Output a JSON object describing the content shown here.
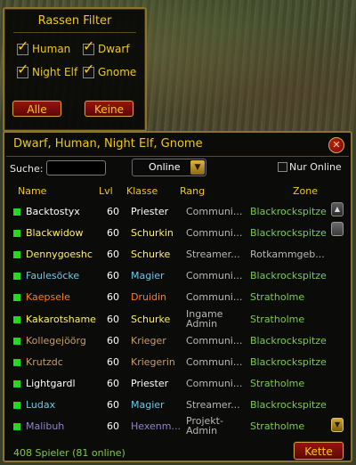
{
  "colors": {
    "gold": "#f2c81f",
    "green_online": "#1fdc1f",
    "zone_green": "#7ec94f",
    "class_priester": "#ffffff",
    "class_schurke": "#fff06a",
    "class_magier": "#6fc6e8",
    "class_druide": "#ff7d0a",
    "class_krieger": "#c79c6e",
    "class_hexenmeister": "#9482c9"
  },
  "filter": {
    "title": "Rassen Filter",
    "races": [
      {
        "label": "Human",
        "checked": true
      },
      {
        "label": "Dwarf",
        "checked": true
      },
      {
        "label": "Night Elf",
        "checked": true
      },
      {
        "label": "Gnome",
        "checked": true
      }
    ],
    "all_label": "Alle",
    "none_label": "Keine"
  },
  "main": {
    "title": "Dwarf, Human, Night Elf, Gnome",
    "close_icon": "close-icon",
    "search_label": "Suche:",
    "search_value": "",
    "dropdown_value": "Online",
    "nur_online_label": "Nur Online",
    "nur_online_checked": false,
    "columns": {
      "name": "Name",
      "lvl": "Lvl",
      "klasse": "Klasse",
      "rang": "Rang",
      "zone": "Zone"
    },
    "rows": [
      {
        "name": "Backtostyx",
        "lvl": "60",
        "klasse": "Priester",
        "rang": "Communi...",
        "zone": "Blackrockspitze",
        "name_color": "#ffffff",
        "class_color": "#ffffff",
        "zone_color": "#7ec94f"
      },
      {
        "name": "Blackwidow",
        "lvl": "60",
        "klasse": "Schurkin",
        "rang": "Communi...",
        "zone": "Blackrockspitze",
        "name_color": "#fff06a",
        "class_color": "#fff06a",
        "zone_color": "#7ec94f"
      },
      {
        "name": "Dennygoeshc",
        "lvl": "60",
        "klasse": "Schurke",
        "rang": "Streamer...",
        "zone": "Rotkammgeb...",
        "name_color": "#fff06a",
        "class_color": "#fff06a",
        "zone_color": "#b8b8b8"
      },
      {
        "name": "Faulesöcke",
        "lvl": "60",
        "klasse": "Magier",
        "rang": "Communi...",
        "zone": "Blackrockspitze",
        "name_color": "#6fc6e8",
        "class_color": "#6fc6e8",
        "zone_color": "#7ec94f"
      },
      {
        "name": "Kaepsele",
        "lvl": "60",
        "klasse": "Druidin",
        "rang": "Communi...",
        "zone": "Stratholme",
        "name_color": "#ff7d0a",
        "class_color": "#ff7d0a",
        "zone_color": "#7ec94f"
      },
      {
        "name": "Kakarotshame",
        "lvl": "60",
        "klasse": "Schurke",
        "rang": "Ingame Admin",
        "rang_lines": [
          "Ingame",
          "Admin"
        ],
        "zone": "Stratholme",
        "name_color": "#fff06a",
        "class_color": "#fff06a",
        "zone_color": "#7ec94f"
      },
      {
        "name": "Kollegejöörg",
        "lvl": "60",
        "klasse": "Krieger",
        "rang": "Communi...",
        "zone": "Blackrockspitze",
        "name_color": "#c79c6e",
        "class_color": "#c79c6e",
        "zone_color": "#7ec94f"
      },
      {
        "name": "Krutzdc",
        "lvl": "60",
        "klasse": "Kriegerin",
        "rang": "Communi...",
        "zone": "Blackrockspitze",
        "name_color": "#c79c6e",
        "class_color": "#c79c6e",
        "zone_color": "#7ec94f"
      },
      {
        "name": "Lightgardl",
        "lvl": "60",
        "klasse": "Priester",
        "rang": "Communi...",
        "zone": "Stratholme",
        "name_color": "#ffffff",
        "class_color": "#ffffff",
        "zone_color": "#7ec94f"
      },
      {
        "name": "Ludax",
        "lvl": "60",
        "klasse": "Magier",
        "rang": "Streamer...",
        "zone": "Blackrockspitze",
        "name_color": "#6fc6e8",
        "class_color": "#6fc6e8",
        "zone_color": "#7ec94f"
      },
      {
        "name": "Malibuh",
        "lvl": "60",
        "klasse": "Hexenm...",
        "rang": "Projekt-Admin",
        "rang_lines": [
          "Projekt-",
          "Admin"
        ],
        "zone": "Stratholme",
        "name_color": "#9482c9",
        "class_color": "#9482c9",
        "zone_color": "#7ec94f"
      }
    ],
    "status": "408 Spieler (81 online)",
    "kette_label": "Kette"
  }
}
